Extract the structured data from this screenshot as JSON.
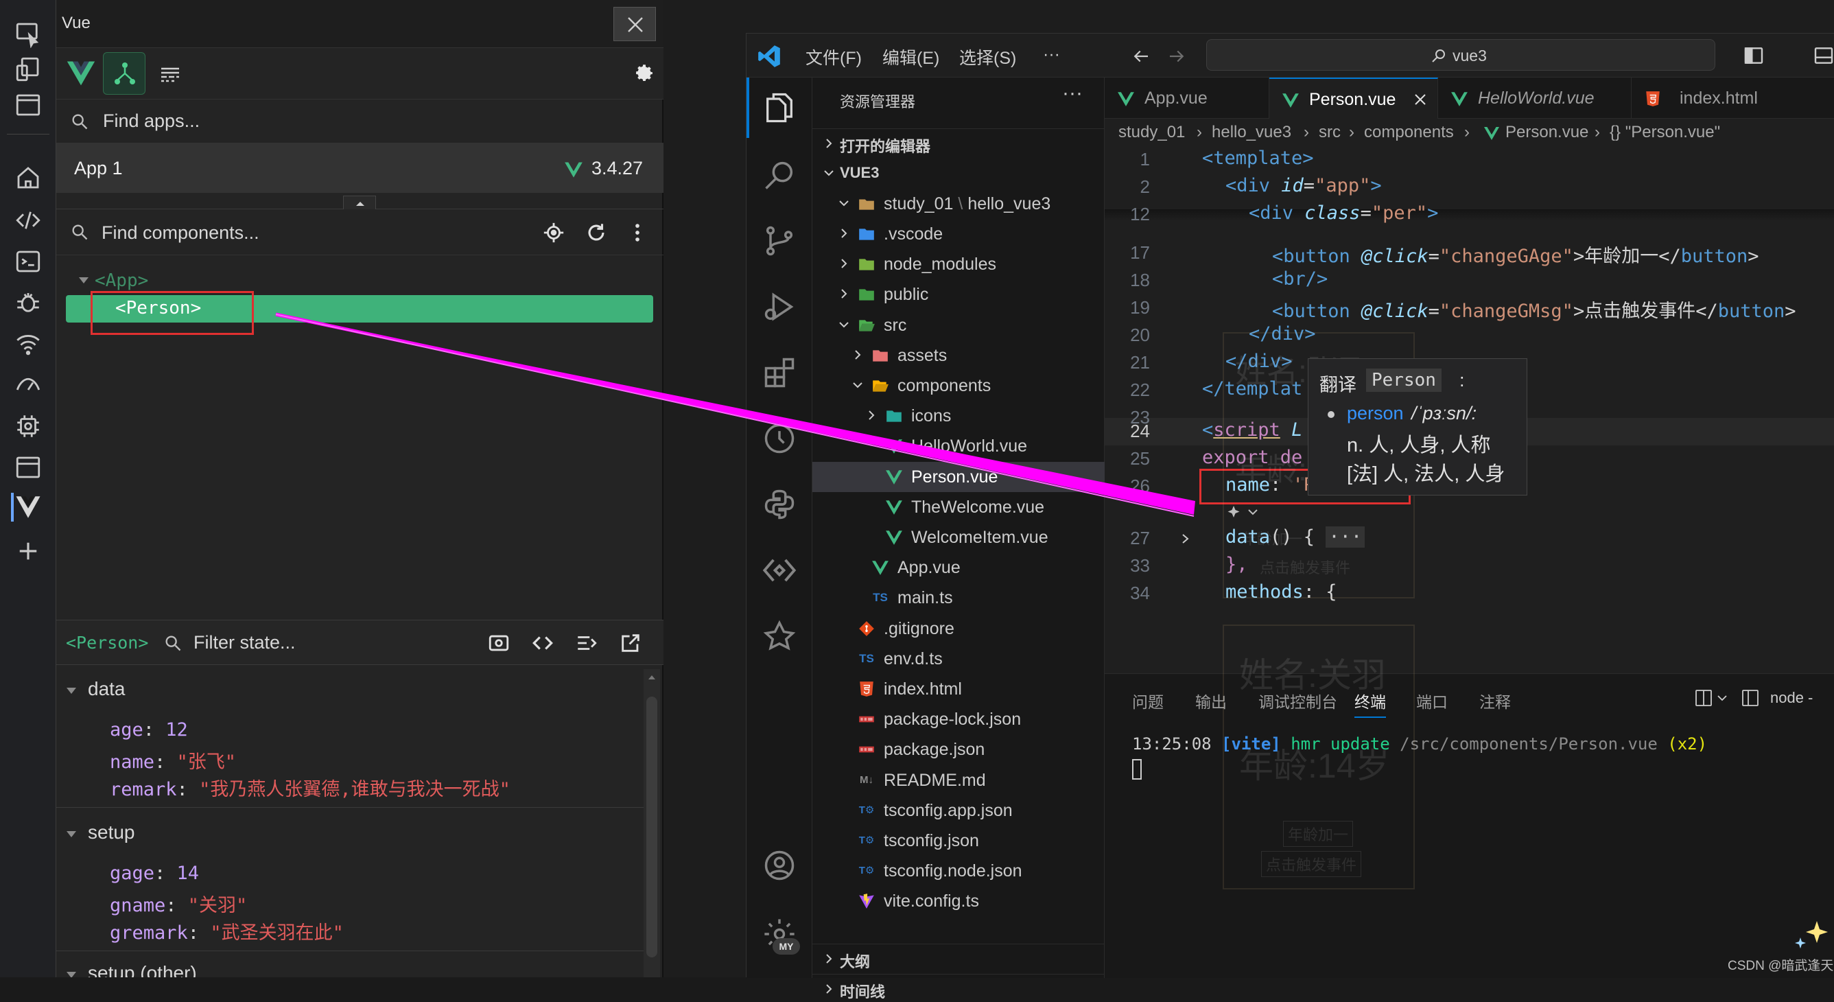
{
  "vue_panel": {
    "title": "Vue",
    "find_apps_placeholder": "Find apps...",
    "app_name": "App 1",
    "vue_version": "3.4.27",
    "find_components_placeholder": "Find components...",
    "tree": {
      "root": "<App>",
      "selected": "<Person>"
    },
    "state_header": {
      "component": "<Person>",
      "filter_placeholder": "Filter state..."
    },
    "data_section": {
      "title": "data",
      "items": [
        {
          "key": "age",
          "value": "12"
        },
        {
          "key": "name",
          "value": "\"张飞\""
        },
        {
          "key": "remark",
          "value": "\"我乃燕人张翼德,谁敢与我决一死战\""
        }
      ]
    },
    "setup_section": {
      "title": "setup",
      "items": [
        {
          "key": "gage",
          "value": "14"
        },
        {
          "key": "gname",
          "value": "\"关羽\""
        },
        {
          "key": "gremark",
          "value": "\"武圣关羽在此\""
        }
      ]
    },
    "setup_other_title": "setup (other)"
  },
  "vscode": {
    "menus": [
      "文件(F)",
      "编辑(E)",
      "选择(S)",
      "···"
    ],
    "search_text": "vue3",
    "explorer_title": "资源管理器",
    "open_editors": "打开的编辑器",
    "workspace": "VUE3",
    "folder_path": {
      "parent": "study_01",
      "child": "hello_vue3"
    },
    "tree": [
      {
        "name": ".vscode",
        "indent": 1,
        "kind": "folder",
        "color": "#3b8eea"
      },
      {
        "name": "node_modules",
        "indent": 1,
        "kind": "folder",
        "color": "#7cb342"
      },
      {
        "name": "public",
        "indent": 1,
        "kind": "folder",
        "color": "#43a047"
      },
      {
        "name": "src",
        "indent": 1,
        "kind": "folder-open",
        "color": "#4caf50"
      },
      {
        "name": "assets",
        "indent": 2,
        "kind": "folder",
        "color": "#e57373"
      },
      {
        "name": "components",
        "indent": 2,
        "kind": "folder-open",
        "color": "#ffb300"
      },
      {
        "name": "icons",
        "indent": 3,
        "kind": "folder",
        "color": "#26a69a"
      },
      {
        "name": "HelloWorld.vue",
        "indent": 3,
        "kind": "vue",
        "color": "#41b883"
      },
      {
        "name": "Person.vue",
        "indent": 3,
        "kind": "vue",
        "color": "#41b883",
        "selected": true
      },
      {
        "name": "TheWelcome.vue",
        "indent": 3,
        "kind": "vue",
        "color": "#41b883"
      },
      {
        "name": "WelcomeItem.vue",
        "indent": 3,
        "kind": "vue",
        "color": "#41b883"
      },
      {
        "name": "App.vue",
        "indent": 2,
        "kind": "vue",
        "color": "#41b883"
      },
      {
        "name": "main.ts",
        "indent": 2,
        "kind": "ts",
        "color": "#3178c6"
      },
      {
        "name": ".gitignore",
        "indent": 1,
        "kind": "git",
        "color": "#e64a19"
      },
      {
        "name": "env.d.ts",
        "indent": 1,
        "kind": "ts",
        "color": "#3178c6"
      },
      {
        "name": "index.html",
        "indent": 1,
        "kind": "html",
        "color": "#e44d26"
      },
      {
        "name": "package-lock.json",
        "indent": 1,
        "kind": "npm",
        "color": "#cb3837"
      },
      {
        "name": "package.json",
        "indent": 1,
        "kind": "npm",
        "color": "#cb3837"
      },
      {
        "name": "README.md",
        "indent": 1,
        "kind": "md",
        "color": "#8a8a8a"
      },
      {
        "name": "tsconfig.app.json",
        "indent": 1,
        "kind": "tsconfig",
        "color": "#3178c6"
      },
      {
        "name": "tsconfig.json",
        "indent": 1,
        "kind": "tsconfig",
        "color": "#3178c6"
      },
      {
        "name": "tsconfig.node.json",
        "indent": 1,
        "kind": "tsconfig",
        "color": "#3178c6"
      },
      {
        "name": "vite.config.ts",
        "indent": 1,
        "kind": "vite",
        "color": "#a855f7"
      }
    ],
    "outline": "大纲",
    "timeline": "时间线",
    "tabs": [
      {
        "label": "App.vue",
        "kind": "vue"
      },
      {
        "label": "Person.vue",
        "kind": "vue",
        "active": true
      },
      {
        "label": "HelloWorld.vue",
        "kind": "vue"
      },
      {
        "label": "index.html",
        "kind": "html"
      }
    ],
    "breadcrumb": [
      "study_01",
      "hello_vue3",
      "src",
      "components",
      "Person.vue",
      "{} \"Person.vue\""
    ],
    "line_numbers": [
      "1",
      "2",
      "12",
      "17",
      "18",
      "19",
      "20",
      "21",
      "22",
      "23",
      "24",
      "25",
      "26",
      "27",
      "33",
      "34"
    ],
    "code": {
      "l1": "<template>",
      "l2_a": "<div ",
      "l2_b": "id",
      "l2_c": "=",
      "l2_d": "\"app\"",
      "l2_e": ">",
      "l12_a": "<div ",
      "l12_b": "class",
      "l12_c": "=",
      "l12_d": "\"per\"",
      "l12_e": ">",
      "l17_a": "<button ",
      "l17_b": "@click",
      "l17_c": "=",
      "l17_d": "\"changeGAge\"",
      "l17_e": ">年龄加一</",
      "l17_f": "button",
      "l17_g": ">",
      "l18": "<br/>",
      "l19_a": "<button ",
      "l19_b": "@click",
      "l19_c": "=",
      "l19_d": "\"changeGMsg\"",
      "l19_e": ">点击触发事件</",
      "l19_f": "button",
      "l19_g": ">",
      "l20": "</div>",
      "l21": "</div>",
      "l22": "</templat",
      "l24_a": "<",
      "l24_b": "script",
      "l24_c": " L",
      "l25_a": "export",
      "l25_b": " de",
      "l26_a": "name",
      "l26_b": ": ",
      "l26_c": "'Person'",
      "l26_d": ",",
      "l27_a": "data",
      "l27_b": "() { ",
      "l27_c": "···",
      "l33": "},",
      "l34_a": "methods",
      "l34_b": ": {"
    },
    "tooltip": {
      "title": "翻译",
      "word": "Person",
      "colon": ":",
      "entry": "person",
      "phonetic": "/ˈpɜːsn/:",
      "def1": "n. 人, 人身, 人称",
      "def2": "[法] 人, 法人, 人身"
    },
    "panel_tabs": [
      "问题",
      "输出",
      "调试控制台",
      "终端",
      "端口",
      "注释"
    ],
    "terminal_name": "node -",
    "terminal_line": {
      "time": "13:25:08 ",
      "tag": "[vite]",
      "msg": " hmr update ",
      "path": "/src/components/Person.vue",
      "count": " (x2)"
    },
    "ghost": {
      "name": "姓名:关羽",
      "age_big": "年龄:14岁",
      "age_small": "年龄:1",
      "name_top": "姓名:张飞",
      "btn1": "年龄加一",
      "btn2": "点击触发事件"
    }
  },
  "watermark": "CSDN @暗武逢天",
  "colors": {
    "vue_green": "#42b883",
    "highlight": "#ff00ff",
    "annotation_red": "#e03030"
  }
}
